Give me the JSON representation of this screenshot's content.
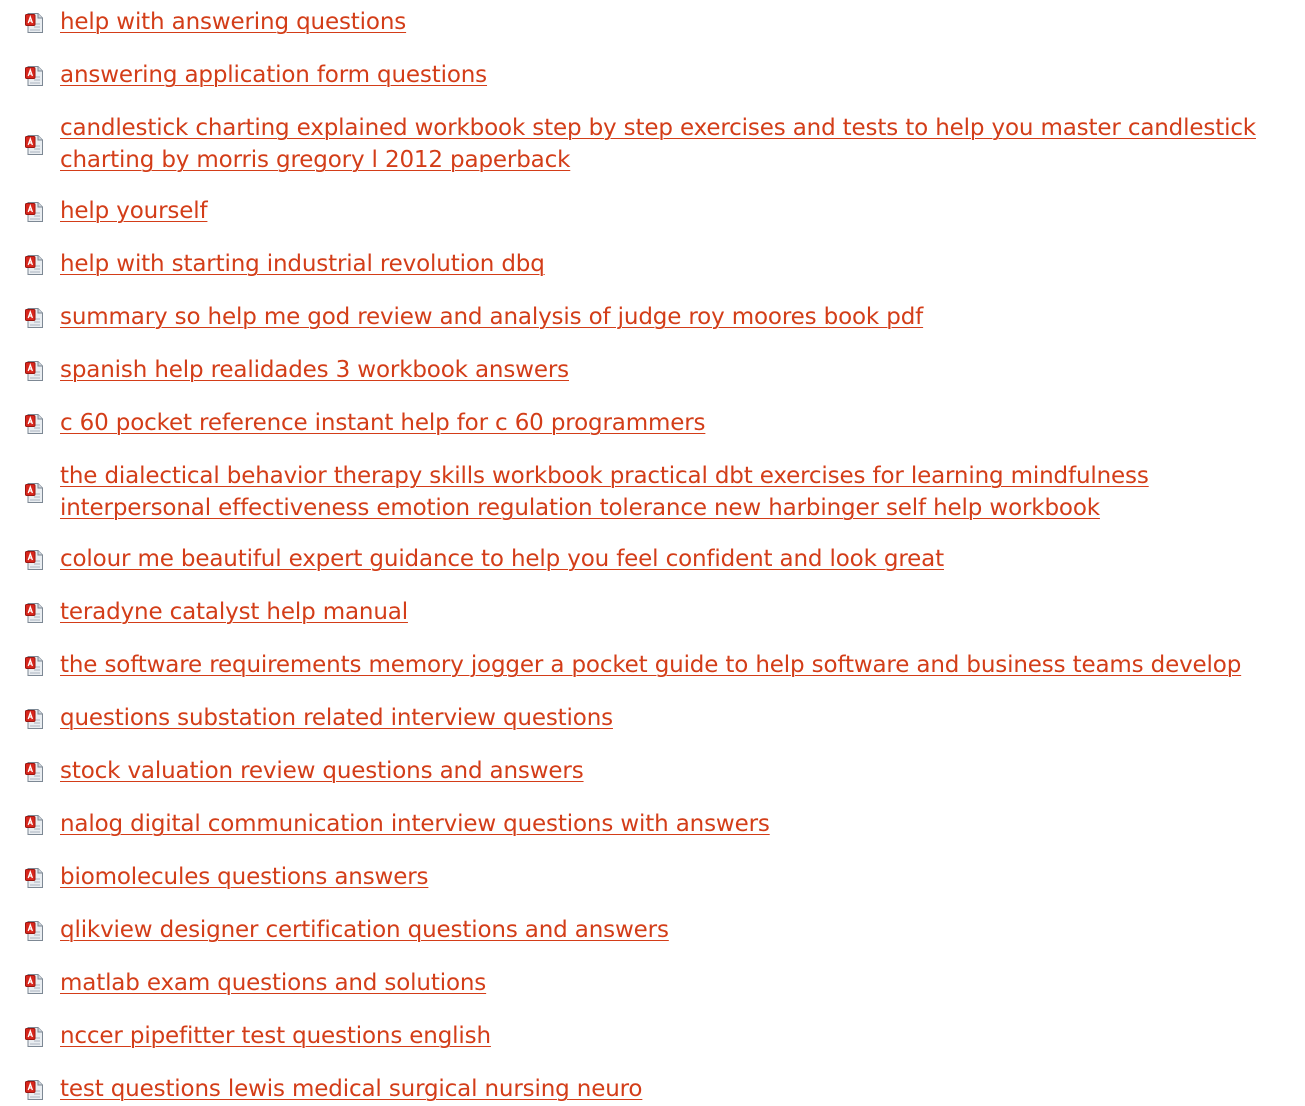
{
  "colors": {
    "link": "#d33d18",
    "icon_red": "#d8261c",
    "icon_paper": "#e9edf1"
  },
  "icon": "pdf-file-icon",
  "links": [
    {
      "title": "help with answering questions"
    },
    {
      "title": "answering application form questions"
    },
    {
      "title": "candlestick charting explained workbook step by step exercises and tests to help you master candlestick charting by morris gregory l 2012 paperback"
    },
    {
      "title": "help yourself"
    },
    {
      "title": "help with starting industrial revolution dbq"
    },
    {
      "title": "summary so help me god review and analysis of judge roy moores book pdf"
    },
    {
      "title": "spanish help realidades 3 workbook answers"
    },
    {
      "title": "c 60 pocket reference instant help for c 60 programmers"
    },
    {
      "title": "the dialectical behavior therapy skills workbook practical dbt exercises for learning mindfulness interpersonal effectiveness emotion regulation tolerance new harbinger self help workbook"
    },
    {
      "title": "colour me beautiful expert guidance to help you feel confident and look great"
    },
    {
      "title": "teradyne catalyst help manual"
    },
    {
      "title": "the software requirements memory jogger a pocket guide to help software and business teams develop"
    },
    {
      "title": "questions substation related interview questions"
    },
    {
      "title": "stock valuation review questions and answers"
    },
    {
      "title": "nalog digital communication interview questions with answers"
    },
    {
      "title": "biomolecules questions answers"
    },
    {
      "title": "qlikview designer certification questions and answers"
    },
    {
      "title": "matlab exam questions and solutions"
    },
    {
      "title": "nccer pipefitter test questions english"
    },
    {
      "title": "test questions lewis medical surgical nursing neuro"
    }
  ]
}
